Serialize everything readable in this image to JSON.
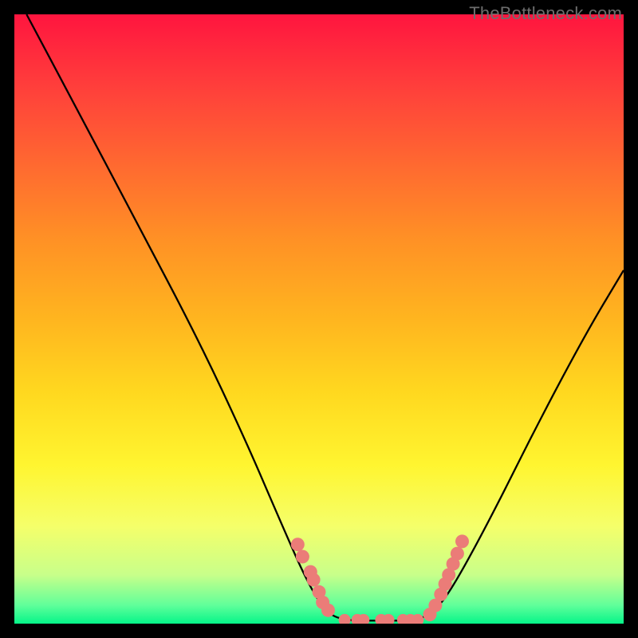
{
  "watermark": "TheBottleneck.com",
  "chart_data": {
    "type": "line",
    "title": "",
    "xlabel": "",
    "ylabel": "",
    "xlim": [
      0,
      100
    ],
    "ylim": [
      0,
      100
    ],
    "series": [
      {
        "name": "curve",
        "description": "V-shaped bottleneck curve",
        "points": [
          {
            "x": 2,
            "y": 100
          },
          {
            "x": 10,
            "y": 85
          },
          {
            "x": 20,
            "y": 66
          },
          {
            "x": 30,
            "y": 47
          },
          {
            "x": 38,
            "y": 30
          },
          {
            "x": 44,
            "y": 16
          },
          {
            "x": 48,
            "y": 7
          },
          {
            "x": 51,
            "y": 2
          },
          {
            "x": 54,
            "y": 0.5
          },
          {
            "x": 60,
            "y": 0.5
          },
          {
            "x": 66,
            "y": 0.5
          },
          {
            "x": 69,
            "y": 2
          },
          {
            "x": 72,
            "y": 6
          },
          {
            "x": 78,
            "y": 17
          },
          {
            "x": 86,
            "y": 33
          },
          {
            "x": 94,
            "y": 48
          },
          {
            "x": 100,
            "y": 58
          }
        ]
      },
      {
        "name": "markers-left",
        "description": "salmon dots left arm",
        "points": [
          {
            "x": 46.5,
            "y": 13
          },
          {
            "x": 47.3,
            "y": 11
          },
          {
            "x": 48.6,
            "y": 8.5
          },
          {
            "x": 49.1,
            "y": 7.2
          },
          {
            "x": 50.0,
            "y": 5.2
          },
          {
            "x": 50.6,
            "y": 3.5
          },
          {
            "x": 51.5,
            "y": 2.2
          }
        ]
      },
      {
        "name": "markers-flat",
        "description": "salmon dots valley floor",
        "points": [
          {
            "x": 54.2,
            "y": 0.6
          },
          {
            "x": 56.3,
            "y": 0.6
          },
          {
            "x": 57.3,
            "y": 0.6
          },
          {
            "x": 60.2,
            "y": 0.6
          },
          {
            "x": 61.4,
            "y": 0.6
          },
          {
            "x": 63.8,
            "y": 0.6
          },
          {
            "x": 65.0,
            "y": 0.6
          },
          {
            "x": 66.2,
            "y": 0.6
          }
        ]
      },
      {
        "name": "markers-right",
        "description": "salmon dots right arm",
        "points": [
          {
            "x": 68.2,
            "y": 1.5
          },
          {
            "x": 69.1,
            "y": 3.0
          },
          {
            "x": 70.0,
            "y": 4.8
          },
          {
            "x": 70.7,
            "y": 6.5
          },
          {
            "x": 71.3,
            "y": 8.0
          },
          {
            "x": 72.0,
            "y": 9.8
          },
          {
            "x": 72.7,
            "y": 11.5
          },
          {
            "x": 73.5,
            "y": 13.5
          }
        ]
      }
    ],
    "colors": {
      "curve": "#000000",
      "markers": "#eb7c78",
      "gradient_top": "#ff153f",
      "gradient_bottom": "#05f589"
    }
  }
}
